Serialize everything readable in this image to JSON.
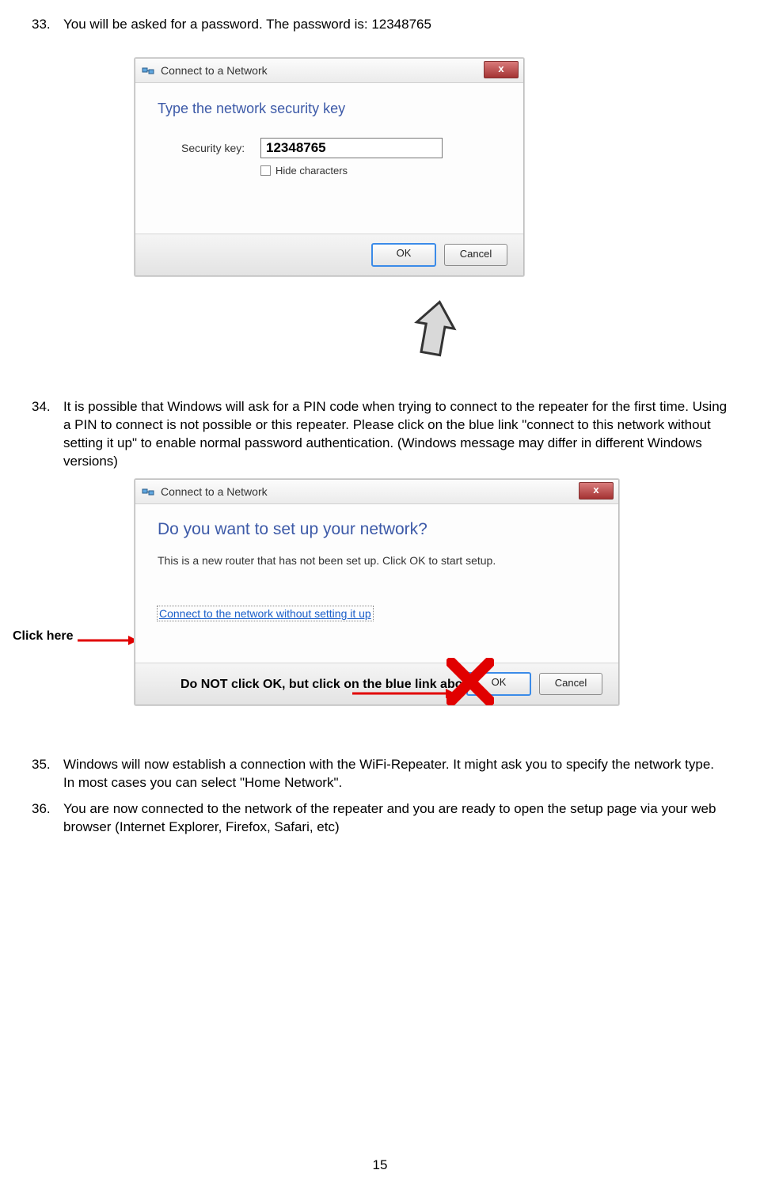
{
  "steps": {
    "s33": {
      "num": "33.",
      "text": "You will be asked for a password. The password is: 12348765"
    },
    "s34": {
      "num": "34.",
      "text": "It is possible that Windows will ask for a PIN code when trying to connect to the repeater for the first time. Using a PIN to connect is not possible or this repeater. Please click on the blue link \"connect to this network without setting it up\" to enable normal password authentication. (Windows message may differ in different Windows versions)"
    },
    "s35": {
      "num": "35.",
      "text": "Windows will now establish a connection with the WiFi-Repeater. It might ask you to specify the network type. In most cases you can select \"Home Network\"."
    },
    "s36": {
      "num": "36.",
      "text": "You are now connected to the network of the repeater and you are ready to open the setup page via your web browser (Internet Explorer, Firefox, Safari, etc)"
    }
  },
  "dialog1": {
    "title": "Connect to a Network",
    "heading": "Type the network security key",
    "field_label": "Security key:",
    "field_value": "12348765",
    "hide_chars": "Hide characters",
    "ok": "OK",
    "cancel": "Cancel",
    "close": "x"
  },
  "dialog2": {
    "title": "Connect to a Network",
    "heading": "Do you want to set up your network?",
    "desc": "This is a new router that has not been set up. Click OK to start setup.",
    "link": "Connect to the network without setting it up",
    "ok": "OK",
    "cancel": "Cancel",
    "close": "x"
  },
  "annotations": {
    "click_here": "Click here",
    "do_not_click": "Do NOT click OK, but click on the blue link above."
  },
  "page_number": "15"
}
